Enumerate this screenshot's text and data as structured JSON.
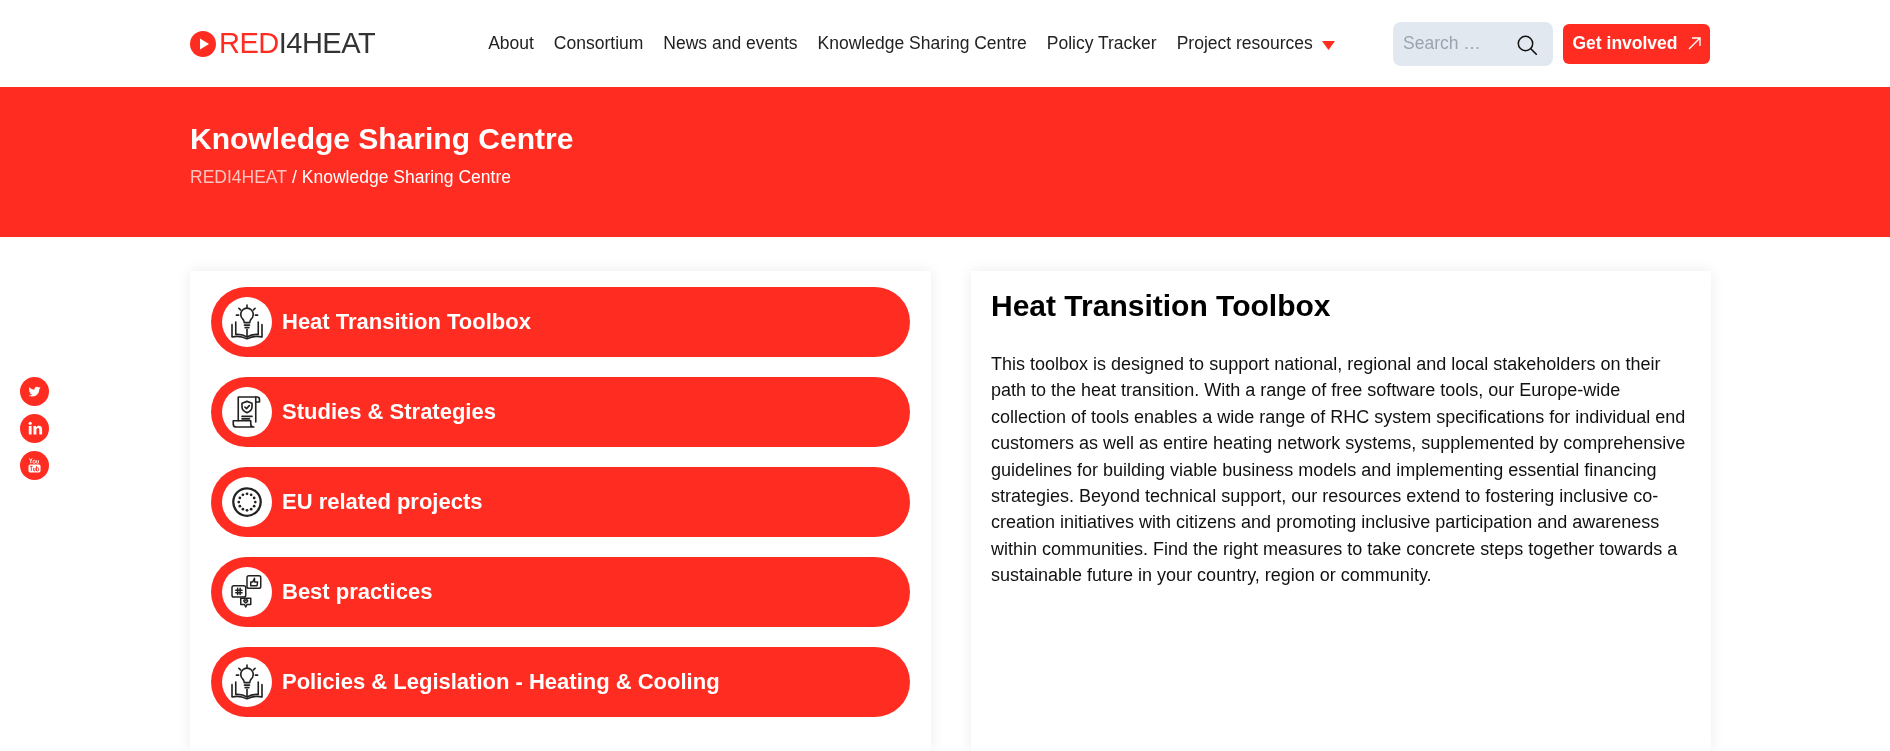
{
  "header": {
    "logo": {
      "lead": "RED",
      "tail": "I4HEAT"
    },
    "nav": [
      {
        "label": "About",
        "dropdown": false
      },
      {
        "label": "Consortium",
        "dropdown": false
      },
      {
        "label": "News and events",
        "dropdown": false
      },
      {
        "label": "Knowledge Sharing Centre",
        "dropdown": false
      },
      {
        "label": "Policy Tracker",
        "dropdown": false
      },
      {
        "label": "Project resources",
        "dropdown": true
      }
    ],
    "search": {
      "placeholder": "Search …"
    },
    "cta": {
      "label": "Get involved"
    }
  },
  "banner": {
    "title": "Knowledge Sharing Centre",
    "separator": "/",
    "breadcrumb": [
      {
        "label": "REDI4HEAT",
        "link": true
      },
      {
        "label": "Knowledge Sharing Centre",
        "link": false
      }
    ]
  },
  "categories": [
    {
      "label": "Heat Transition Toolbox"
    },
    {
      "label": "Studies & Strategies"
    },
    {
      "label": "EU related projects"
    },
    {
      "label": "Best practices"
    },
    {
      "label": "Policies & Legislation - Heating & Cooling"
    }
  ],
  "detail": {
    "title": "Heat Transition Toolbox",
    "body": "This toolbox is designed to support national, regional and local stakeholders on their path to the heat transition. With a range of free software tools, our Europe-wide collection of tools enables a wide range of RHC system specifications for individual end customers as well as entire heating network systems, supplemented by comprehensive guidelines for building viable business models and implementing essential financing strategies. Beyond technical support, our resources extend to fostering inclusive co-creation initiatives with citizens and promoting inclusive participation and awareness within communities. Find the right measures to take concrete steps together towards a sustainable future in your country, region or community."
  }
}
